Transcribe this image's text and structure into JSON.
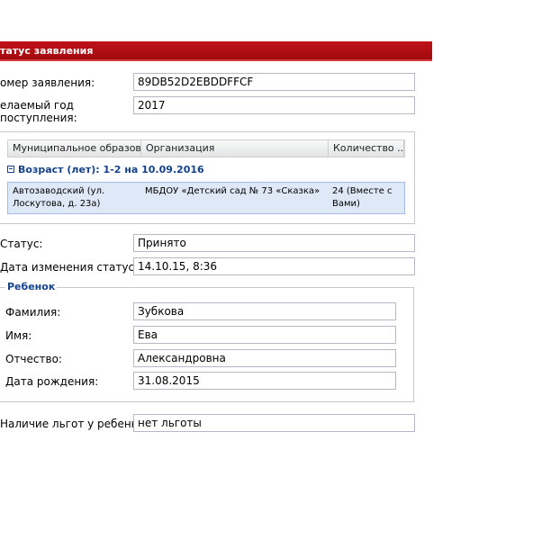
{
  "panel": {
    "title": "татус заявления"
  },
  "form": {
    "number": {
      "label": "омер заявления:",
      "value": "89DB52D2EBDDFFCF"
    },
    "year": {
      "label": "елаемый год поступления:",
      "value": "2017"
    },
    "status": {
      "label": "Статус:",
      "value": "Принято"
    },
    "status_date": {
      "label": "Дата изменения статуса:",
      "value": "14.10.15, 8:36"
    },
    "benefits": {
      "label": "Наличие льгот у ребенка:",
      "value": "нет льготы"
    }
  },
  "grid": {
    "columns": [
      "Муниципальное образов...",
      "Организация",
      "Количество ..."
    ],
    "group": "Возраст (лет): 1-2 на 10.09.2016",
    "rows": [
      {
        "municipality": "Автозаводский (ул. Лоскутова, д. 23а)",
        "organization": "МБДОУ «Детский сад № 73 «Сказка»",
        "count": "24 (Вместе с Вами)"
      }
    ]
  },
  "child": {
    "legend": "Ребенок",
    "surname": {
      "label": "Фамилия:",
      "value": "Зубкова"
    },
    "name": {
      "label": "Имя:",
      "value": "Ева"
    },
    "patronymic": {
      "label": "Отчество:",
      "value": "Александровна"
    },
    "birthdate": {
      "label": "Дата рождения:",
      "value": "31.08.2015"
    }
  }
}
